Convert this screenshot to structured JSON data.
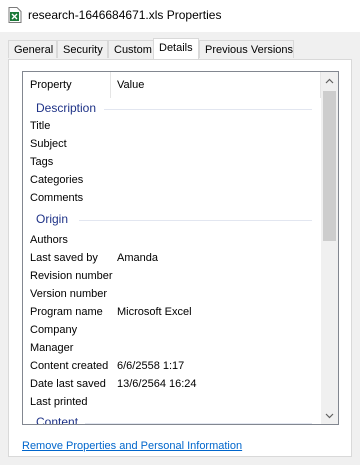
{
  "window": {
    "title": "research-1646684671.xls Properties",
    "icon": "excel-file-icon"
  },
  "tabs": [
    {
      "label": "General"
    },
    {
      "label": "Security"
    },
    {
      "label": "Custom"
    },
    {
      "label": "Details",
      "active": true
    },
    {
      "label": "Previous Versions"
    }
  ],
  "listview": {
    "header": {
      "property": "Property",
      "value": "Value"
    },
    "groups": {
      "description": "Description",
      "origin": "Origin",
      "content": "Content"
    },
    "description_rows": [
      {
        "property": "Title",
        "value": ""
      },
      {
        "property": "Subject",
        "value": ""
      },
      {
        "property": "Tags",
        "value": ""
      },
      {
        "property": "Categories",
        "value": ""
      },
      {
        "property": "Comments",
        "value": ""
      }
    ],
    "origin_rows": [
      {
        "property": "Authors",
        "value": ""
      },
      {
        "property": "Last saved by",
        "value": "Amanda"
      },
      {
        "property": "Revision number",
        "value": ""
      },
      {
        "property": "Version number",
        "value": ""
      },
      {
        "property": "Program name",
        "value": "Microsoft Excel"
      },
      {
        "property": "Company",
        "value": ""
      },
      {
        "property": "Manager",
        "value": ""
      },
      {
        "property": "Content created",
        "value": "6/6/2558 1:17"
      },
      {
        "property": "Date last saved",
        "value": "13/6/2564 16:24"
      },
      {
        "property": "Last printed",
        "value": ""
      }
    ]
  },
  "remove_link": "Remove Properties and Personal Information",
  "colors": {
    "group_header": "#1e3287",
    "link": "#0066cc",
    "excel_green": "#1d7a3a"
  }
}
